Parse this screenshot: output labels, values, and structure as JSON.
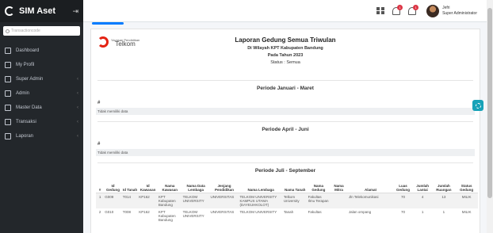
{
  "brand": {
    "name": "SIM Aset"
  },
  "sidebar": {
    "search_placeholder": "Transactioncode",
    "items": [
      {
        "label": "Dashboard",
        "icon": "home-icon",
        "has_children": false
      },
      {
        "label": "My Profil",
        "icon": "id-card-icon",
        "has_children": false
      },
      {
        "label": "Super Admin",
        "icon": "users-icon",
        "has_children": true
      },
      {
        "label": "Admin",
        "icon": "user-icon",
        "has_children": true
      },
      {
        "label": "Master Data",
        "icon": "database-icon",
        "has_children": true
      },
      {
        "label": "Transaksi",
        "icon": "transfer-icon",
        "has_children": true
      },
      {
        "label": "Laporan",
        "icon": "report-icon",
        "has_children": true
      }
    ]
  },
  "topbar": {
    "notification_count": "1",
    "message_count": "1",
    "user_name": "Jefri",
    "user_role": "Super Administrator"
  },
  "report": {
    "title": "Laporan Gedung Semua Triwulan",
    "subtitle": "Di Wilayah KPT Kabupaten Bandung",
    "year_line": "Pada Tahun 2023",
    "status_line": "Status : Semua",
    "logo_small": "Yayasan Pendidikan",
    "logo_name": "Telkom"
  },
  "periods": [
    {
      "title": "Periode Januari - Maret",
      "hash": "#",
      "empty_text": "Tidak memiliki data"
    },
    {
      "title": "Periode April - Juni",
      "hash": "#",
      "empty_text": "Tidak memiliki data"
    },
    {
      "title": "Periode Juli - September"
    }
  ],
  "table": {
    "headers": [
      "#",
      "Id Gedung",
      "Id Tanah",
      "Id Kawasan",
      "Nama Kawasan",
      "Nama Data Lembaga",
      "Jenjang Pendidikan",
      "Nama Lembaga",
      "Nama Tanah",
      "Nama Gedung",
      "Nama Mitra",
      "Alamat",
      "Luas Gedung",
      "Jumlah Lantai",
      "Jumlah Ruangan",
      "Status Gedung"
    ],
    "rows": [
      [
        "1",
        "G009",
        "T014",
        "KP162",
        "KPT Kabupaten Bandung",
        "TELKOM UNIVERSITY",
        "UNIVERSITAS",
        "TELKOM UNIVERSITY KAMPUS UTAMA (DAYEUHKOLOT)",
        "Telkom University",
        "Fakultas Ilmu Terapan",
        "",
        "Jln Telekomunikasi",
        "70",
        "4",
        "13",
        "MILIK"
      ],
      [
        "2",
        "G010",
        "T008",
        "KP162",
        "KPT Kabupaten Bandung",
        "TELKOM UNIVERSITY",
        "UNIVERSITAS",
        "TELKOM UNIVERSITY",
        "Tanah",
        "Fakultas",
        "",
        "Jalan ompang",
        "70",
        "1",
        "1",
        "MILIK"
      ]
    ]
  },
  "colors": {
    "sidebar": "#23272b",
    "accent": "#007bff",
    "fab": "#17a2b8",
    "badge": "#dc3545"
  }
}
